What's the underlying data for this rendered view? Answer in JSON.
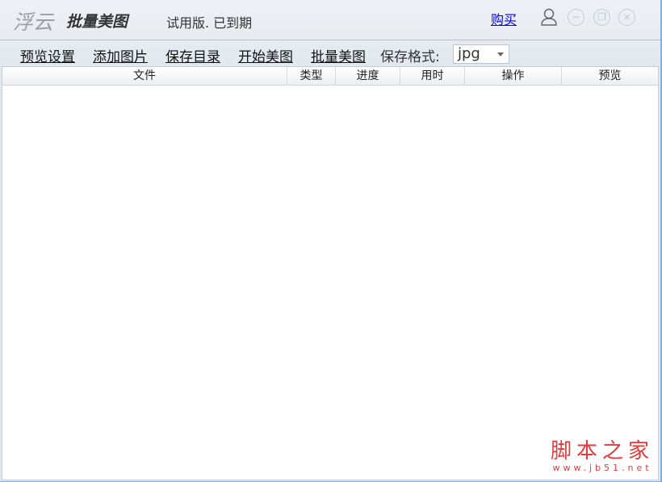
{
  "titlebar": {
    "logo_main": "浮云",
    "logo_app": "批量美图",
    "status": "试用版. 已到期",
    "buy_link": "购买"
  },
  "toolbar": {
    "items": [
      "预览设置",
      "添加图片",
      "保存目录",
      "开始美图",
      "批量美图"
    ],
    "format_label": "保存格式:",
    "format_value": "jpg"
  },
  "table": {
    "columns": [
      "文件",
      "类型",
      "进度",
      "用时",
      "操作",
      "预览"
    ],
    "rows": []
  },
  "watermark": {
    "title": "脚本之家",
    "url": "www.jb51.net"
  }
}
